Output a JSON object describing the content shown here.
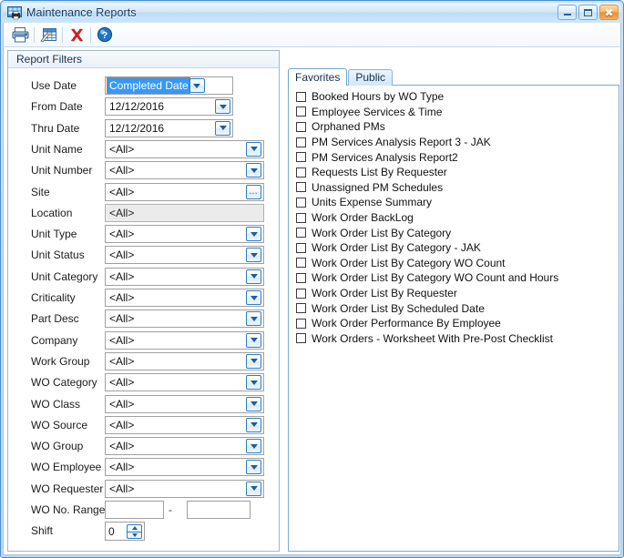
{
  "window": {
    "title": "Maintenance Reports",
    "icon": "report-grid-printer-icon",
    "buttons": {
      "minimize": "–",
      "maximize": "□",
      "close": "✕"
    }
  },
  "toolbar": {
    "items": [
      {
        "name": "print-button",
        "icon": "printer-icon",
        "label": "Print"
      },
      {
        "name": "preview-grid-button",
        "icon": "grid-edit-icon",
        "label": "Grid"
      },
      {
        "name": "delete-button",
        "icon": "red-x-icon",
        "label": "Delete"
      },
      {
        "name": "help-button",
        "icon": "help-question-icon",
        "label": "Help"
      }
    ]
  },
  "filters": {
    "header": "Report Filters",
    "rows": [
      {
        "label": "Use Date",
        "value": "Completed Date",
        "control": "combo",
        "selected": true,
        "width": "narrow"
      },
      {
        "label": "From Date",
        "value": "12/12/2016",
        "control": "combo",
        "selected": false,
        "width": "narrow"
      },
      {
        "label": "Thru Date",
        "value": "12/12/2016",
        "control": "combo",
        "selected": false,
        "width": "narrow"
      },
      {
        "label": "Unit Name",
        "value": "<All>",
        "control": "combo",
        "selected": false,
        "width": "wide"
      },
      {
        "label": "Unit Number",
        "value": "<All>",
        "control": "combo",
        "selected": false,
        "width": "wide"
      },
      {
        "label": "Site",
        "value": "<All>",
        "control": "ellipsis",
        "selected": false,
        "width": "wide"
      },
      {
        "label": "Location",
        "value": "<All>",
        "control": "disabled",
        "selected": false,
        "width": "wide"
      },
      {
        "label": "Unit Type",
        "value": "<All>",
        "control": "combo",
        "selected": false,
        "width": "wide"
      },
      {
        "label": "Unit Status",
        "value": "<All>",
        "control": "combo",
        "selected": false,
        "width": "wide"
      },
      {
        "label": "Unit Category",
        "value": "<All>",
        "control": "combo",
        "selected": false,
        "width": "wide"
      },
      {
        "label": "Criticality",
        "value": "<All>",
        "control": "combo",
        "selected": false,
        "width": "wide"
      },
      {
        "label": "Part Desc",
        "value": "<All>",
        "control": "combo",
        "selected": false,
        "width": "wide"
      },
      {
        "label": "Company",
        "value": "<All>",
        "control": "combo",
        "selected": false,
        "width": "wide"
      },
      {
        "label": "Work Group",
        "value": "<All>",
        "control": "combo",
        "selected": false,
        "width": "wide"
      },
      {
        "label": "WO Category",
        "value": "<All>",
        "control": "combo",
        "selected": false,
        "width": "wide"
      },
      {
        "label": "WO Class",
        "value": "<All>",
        "control": "combo",
        "selected": false,
        "width": "wide"
      },
      {
        "label": "WO Source",
        "value": "<All>",
        "control": "combo",
        "selected": false,
        "width": "wide"
      },
      {
        "label": "WO Group",
        "value": "<All>",
        "control": "combo",
        "selected": false,
        "width": "wide"
      },
      {
        "label": "WO Employee",
        "value": "<All>",
        "control": "combo",
        "selected": false,
        "width": "wide"
      },
      {
        "label": "WO Requester",
        "value": "<All>",
        "control": "combo",
        "selected": false,
        "width": "wide"
      }
    ],
    "wo_no_range": {
      "label": "WO No. Range",
      "from": "",
      "to": "",
      "separator": "-"
    },
    "shift": {
      "label": "Shift",
      "value": "0"
    }
  },
  "reports": {
    "tabs": [
      {
        "label": "Favorites",
        "active": true
      },
      {
        "label": "Public",
        "active": false
      }
    ],
    "items": [
      {
        "label": "Booked Hours by WO Type",
        "checked": false
      },
      {
        "label": "Employee Services & Time",
        "checked": false
      },
      {
        "label": "Orphaned PMs",
        "checked": false
      },
      {
        "label": "PM Services Analysis Report 3 - JAK",
        "checked": false
      },
      {
        "label": "PM Services Analysis Report2",
        "checked": false
      },
      {
        "label": "Requests List By Requester",
        "checked": false
      },
      {
        "label": "Unassigned PM Schedules",
        "checked": false
      },
      {
        "label": "Units Expense Summary",
        "checked": false
      },
      {
        "label": "Work Order BackLog",
        "checked": false
      },
      {
        "label": "Work Order List By Category",
        "checked": false
      },
      {
        "label": "Work Order List By Category - JAK",
        "checked": false
      },
      {
        "label": "Work Order List By Category WO Count",
        "checked": false
      },
      {
        "label": "Work Order List By Category WO Count and Hours",
        "checked": false
      },
      {
        "label": "Work Order List By Requester",
        "checked": false
      },
      {
        "label": "Work Order List By Scheduled Date",
        "checked": false
      },
      {
        "label": "Work Order Performance By Employee",
        "checked": false
      },
      {
        "label": "Work Orders - Worksheet With Pre-Post Checklist",
        "checked": false
      }
    ]
  },
  "colors": {
    "frame": "#4a8fd0",
    "title_text": "#123a6b",
    "accent_blue": "#2d7ec4",
    "selection": "#3399ff",
    "close_orange": "#f08a2c",
    "delete_red": "#cc2222"
  }
}
